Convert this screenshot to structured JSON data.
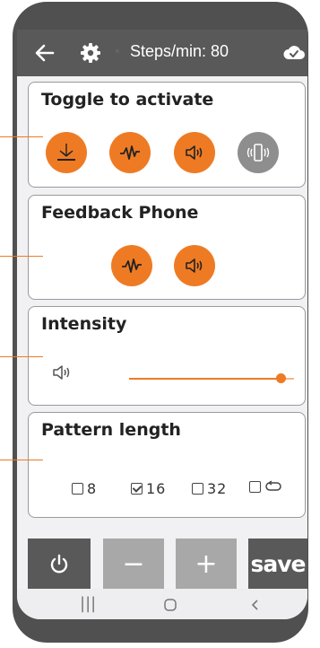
{
  "header": {
    "steps_label": "Steps/min: 80"
  },
  "toggle_card": {
    "title": "Toggle to activate",
    "buttons": [
      {
        "icon": "step-impact-icon",
        "active": true
      },
      {
        "icon": "vibration-icon",
        "active": true
      },
      {
        "icon": "sound-icon",
        "active": true
      },
      {
        "icon": "phone-vibrate-icon",
        "active": false
      }
    ]
  },
  "feedback_card": {
    "title": "Feedback Phone",
    "buttons": [
      {
        "icon": "vibration-icon",
        "active": true
      },
      {
        "icon": "sound-icon",
        "active": true
      }
    ]
  },
  "intensity_card": {
    "title": "Intensity",
    "value": 0.92
  },
  "pattern_card": {
    "title": "Pattern length",
    "options": [
      {
        "label": "8",
        "checked": false
      },
      {
        "label": "16",
        "checked": true
      },
      {
        "label": "32",
        "checked": false
      },
      {
        "label": "",
        "checked": false,
        "icon": "loop-icon"
      }
    ]
  },
  "controls": {
    "minus": "−",
    "plus": "+",
    "save": "save"
  },
  "colors": {
    "accent": "#ee7b23",
    "dark": "#595959",
    "light": "#a8a8a8",
    "inactive": "#8e8e8e"
  }
}
